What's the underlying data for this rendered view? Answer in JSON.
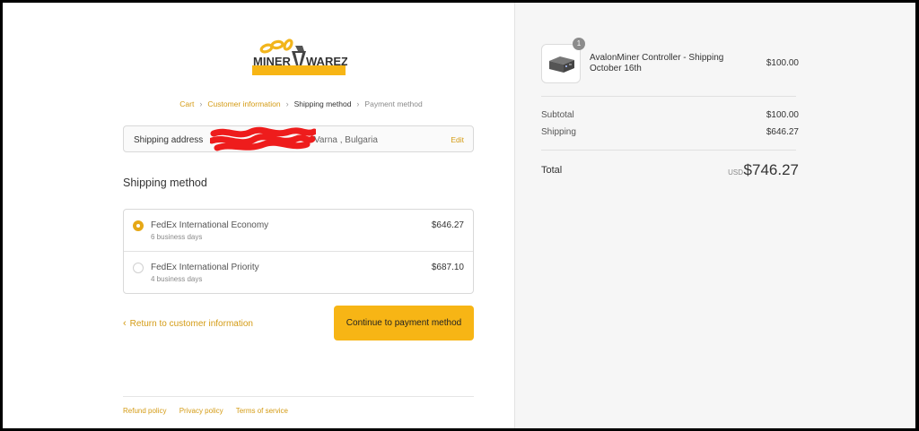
{
  "brand": {
    "logo_text_left": "MINER",
    "logo_text_right": "WAREZ",
    "accent_color": "#f7b515",
    "link_color": "#d49b14"
  },
  "breadcrumb": [
    {
      "label": "Cart",
      "state": "done"
    },
    {
      "label": "Customer information",
      "state": "done"
    },
    {
      "label": "Shipping method",
      "state": "current"
    },
    {
      "label": "Payment method",
      "state": "upcoming"
    }
  ],
  "address": {
    "label": "Shipping address",
    "value": "Varna , Bulgaria",
    "edit_label": "Edit"
  },
  "shipping": {
    "title": "Shipping method",
    "options": [
      {
        "name": "FedEx International Economy",
        "subtitle": "6 business days",
        "price": "$646.27",
        "selected": true
      },
      {
        "name": "FedEx International Priority",
        "subtitle": "4 business days",
        "price": "$687.10",
        "selected": false
      }
    ]
  },
  "actions": {
    "return_label": "Return to customer information",
    "continue_label": "Continue to payment method",
    "chevron_icon": "chevron-left-icon"
  },
  "footer": {
    "links": [
      "Refund policy",
      "Privacy policy",
      "Terms of service"
    ]
  },
  "order": {
    "product": {
      "name": "AvalonMiner Controller - Shipping October 16th",
      "quantity": "1",
      "price": "$100.00",
      "icon": "controller-box-icon"
    },
    "subtotal_label": "Subtotal",
    "subtotal": "$100.00",
    "shipping_label": "Shipping",
    "shipping": "$646.27",
    "total_label": "Total",
    "currency": "USD",
    "total": "$746.27"
  }
}
